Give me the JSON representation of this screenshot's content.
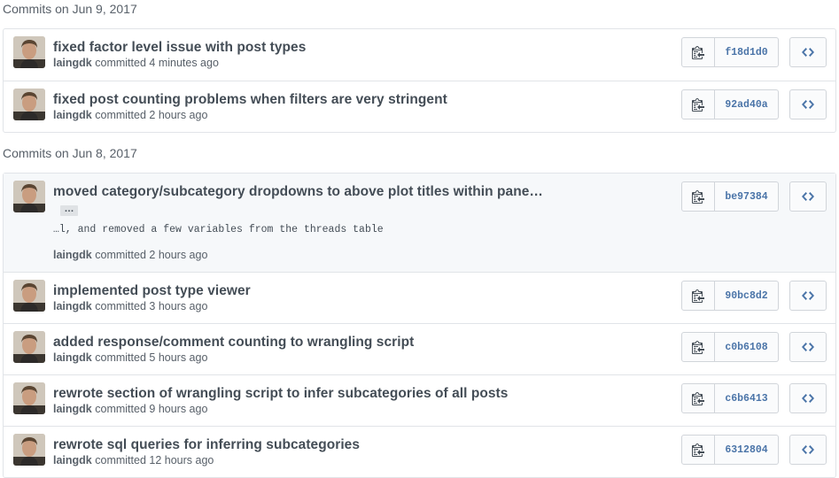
{
  "groups": [
    {
      "header": "Commits on Jun 9, 2017",
      "commits": [
        {
          "title": "fixed factor level issue with post types",
          "author": "laingdk",
          "committed": "committed",
          "time": "4 minutes ago",
          "sha": "f18d1d0",
          "expanded": false
        },
        {
          "title": "fixed post counting problems when filters are very stringent",
          "author": "laingdk",
          "committed": "committed",
          "time": "2 hours ago",
          "sha": "92ad40a",
          "expanded": false
        }
      ]
    },
    {
      "header": "Commits on Jun 8, 2017",
      "commits": [
        {
          "title": "moved category/subcategory dropdowns to above plot titles within pane…",
          "author": "laingdk",
          "committed": "committed",
          "time": "2 hours ago",
          "sha": "be97384",
          "expanded": true,
          "ellipsis": "…",
          "description": "…l, and removed a few variables from the threads table"
        },
        {
          "title": "implemented post type viewer",
          "author": "laingdk",
          "committed": "committed",
          "time": "3 hours ago",
          "sha": "90bc8d2",
          "expanded": false
        },
        {
          "title": "added response/comment counting to wrangling script",
          "author": "laingdk",
          "committed": "committed",
          "time": "5 hours ago",
          "sha": "c0b6108",
          "expanded": false
        },
        {
          "title": "rewrote section of wrangling script to infer subcategories of all posts",
          "author": "laingdk",
          "committed": "committed",
          "time": "9 hours ago",
          "sha": "c6b6413",
          "expanded": false
        },
        {
          "title": "rewrote sql queries for inferring subcategories",
          "author": "laingdk",
          "committed": "committed",
          "time": "12 hours ago",
          "sha": "6312804",
          "expanded": false
        }
      ]
    }
  ],
  "icons": {
    "copy": "clipboard-icon",
    "browse": "code-icon"
  },
  "colors": {
    "sha": "#4a74a8",
    "border": "#e1e4e8",
    "expanded_bg": "#f6f8fa"
  }
}
